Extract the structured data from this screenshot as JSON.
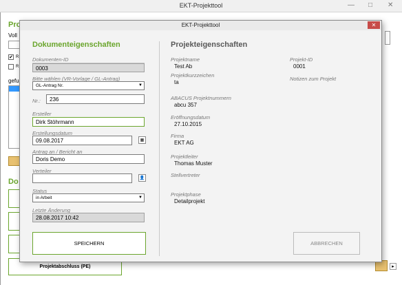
{
  "main_window": {
    "title": "EKT-Projekttool",
    "minimize": "—",
    "maximize": "□",
    "close": "✕",
    "left_peek": {
      "heading_1": "Proj",
      "label_1": "Voll",
      "row_r1": "R",
      "row_r2": "R",
      "label_2": "gefu",
      "heading_2": "Do",
      "bottom_button": "Projektabschluss (PE)"
    }
  },
  "dialog": {
    "title": "EKT-Projekttool",
    "close": "✕",
    "left": {
      "heading": "Dokumenteigenschaften",
      "dokumenten_id_label": "Dokumenten-ID",
      "dokumenten_id": "0003",
      "vorlage_label": "Bitte wählen (VR-Vorlage / GL-Antrag)",
      "vorlage_value": "GL-Antrag Nr.",
      "nr_label": "Nr.:",
      "nr_value": "236",
      "ersteller_label": "Ersteller",
      "ersteller_value": "Dirk Stöhrmann",
      "erstellungsdatum_label": "Erstellungsdatum",
      "erstellungsdatum_value": "09.08.2017",
      "antrag_label": "Antrag an / Bericht an",
      "antrag_value": "Doris Demo",
      "verteiler_label": "Verteiler",
      "verteiler_value": "",
      "status_label": "Status",
      "status_value": "in Arbeit",
      "letzte_aenderung_label": "Letzte Änderung",
      "letzte_aenderung_value": "28.08.2017 10:42",
      "save_button": "SPEICHERN"
    },
    "right": {
      "heading": "Projekteigenschaften",
      "projektname_label": "Projektname",
      "projektname": "Test Ab",
      "projektkurz_label": "Projektkurzzeichen",
      "projektkurz": "ta",
      "abacus_label": "ABACUS Projektnummern",
      "abacus": "abcu 357",
      "eroeffnung_label": "Eröffnungsdatum",
      "eroeffnung": "27.10.2015",
      "firma_label": "Firma",
      "firma": "EKT AG",
      "projektleiter_label": "Projektleiter",
      "projektleiter": "Thomas Muster",
      "stellvertreter_label": "Stellvertreter",
      "stellvertreter": "",
      "projektphase_label": "Projektphase",
      "projektphase": "Detailprojekt",
      "projekt_id_label": "Projekt-ID",
      "projekt_id": "0001",
      "notizen_label": "Notizen zum Projekt",
      "cancel_button": "ABBRECHEN"
    }
  }
}
